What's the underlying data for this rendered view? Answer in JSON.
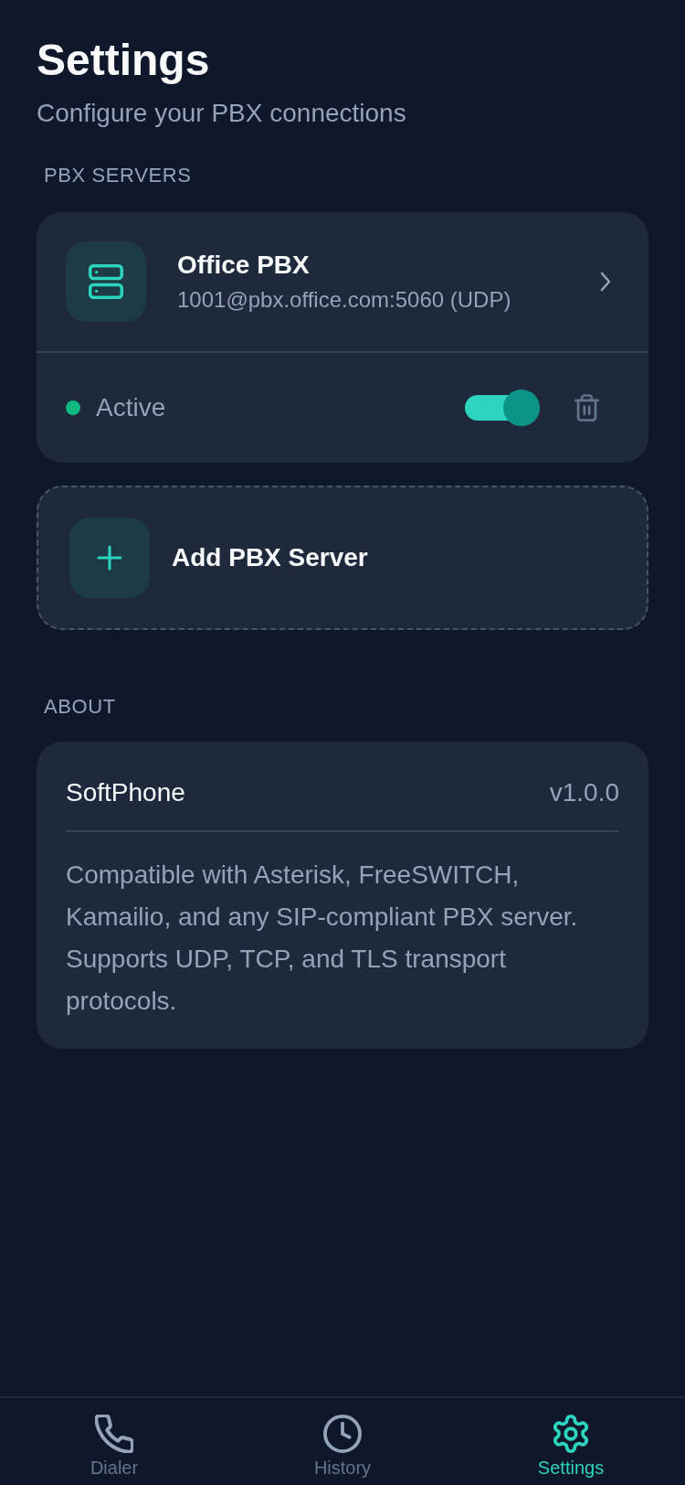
{
  "header": {
    "title": "Settings",
    "subtitle": "Configure your PBX connections"
  },
  "servers_section": {
    "label": "PBX SERVERS",
    "servers": [
      {
        "name": "Office PBX",
        "address": "1001@pbx.office.com:5060 (UDP)",
        "status": "Active",
        "color": "#10b981",
        "enabled": true
      }
    ]
  },
  "add_button": {
    "label": "Add PBX Server"
  },
  "about": {
    "label": "ABOUT",
    "app_name": "SoftPhone",
    "version": "v1.0.0",
    "description": "Compatible with Asterisk, FreeSWITCH, Kamailio, and any SIP-compliant PBX server. Supports UDP, TCP, and TLS transport protocols."
  },
  "nav": [
    {
      "label": "Dialer",
      "selected": false
    },
    {
      "label": "History",
      "selected": false
    },
    {
      "label": "Settings",
      "selected": true
    }
  ]
}
